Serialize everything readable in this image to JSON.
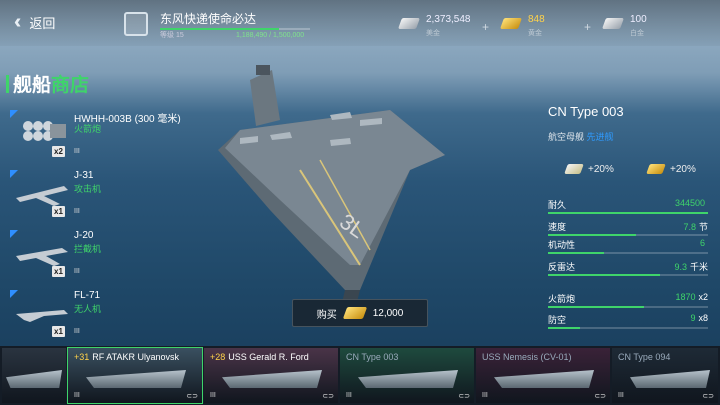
{
  "topbar": {
    "back_label": "返回",
    "mission_title": "东风快递使命必达",
    "mission_level": "等级 15",
    "mission_progress_text": "1,188,490 / 1,500,000",
    "mission_progress": 0.79,
    "resources": [
      {
        "value": "2,373,548",
        "label": "美金",
        "kind": "silver"
      },
      {
        "value": "848",
        "label": "黄金",
        "kind": "gold"
      },
      {
        "value": "100",
        "label": "白金",
        "kind": "silver"
      }
    ]
  },
  "shop": {
    "title_white": "舰船",
    "title_green": "商店",
    "items": [
      {
        "name": "HWHH-003B (300 毫米)",
        "sub": "火箭炮",
        "qty": "x2",
        "lvl": "III",
        "icon": "rocket-launcher-icon"
      },
      {
        "name": "J-31",
        "sub": "攻击机",
        "qty": "x1",
        "lvl": "III",
        "icon": "jet-icon"
      },
      {
        "name": "J-20",
        "sub": "拦截机",
        "qty": "x1",
        "lvl": "III",
        "icon": "jet-icon"
      },
      {
        "name": "FL-71",
        "sub": "无人机",
        "qty": "x1",
        "lvl": "III",
        "icon": "drone-icon"
      }
    ]
  },
  "ship": {
    "name": "CN Type 003",
    "type_prefix": "航空母舰",
    "type_highlight": "先进舰",
    "bonuses": [
      "+20%",
      "+20%"
    ],
    "stats": [
      {
        "label": "耐久",
        "value": "344500",
        "unit": "",
        "fill": 1.0
      },
      {
        "label": "速度",
        "value": "7.8",
        "unit": "节",
        "fill": 0.55
      },
      {
        "label": "机动性",
        "value": "6",
        "unit": "",
        "fill": 0.35
      },
      {
        "label": "反雷达",
        "value": "9.3",
        "unit": "千米",
        "fill": 0.7
      },
      {
        "label": "火箭炮",
        "value": "1870",
        "unit": "x2",
        "fill": 0.6
      },
      {
        "label": "防空",
        "value": "9",
        "unit": "x8",
        "fill": 0.2
      }
    ],
    "buy_label": "购买",
    "price": "12,000"
  },
  "shipbar": [
    {
      "name": "",
      "bonus": "",
      "tier": "",
      "bg": "#2a3440"
    },
    {
      "name": "RF ATAKR Ulyanovsk",
      "bonus": "+31",
      "tier": "III",
      "bg": "#3a5060"
    },
    {
      "name": "USS Gerald R. Ford",
      "bonus": "+28",
      "tier": "III",
      "bg": "#4a3448"
    },
    {
      "name": "CN Type 003",
      "bonus": "",
      "tier": "III",
      "bg": "#1e4a3e"
    },
    {
      "name": "USS Nemesis (CV-01)",
      "bonus": "",
      "tier": "III",
      "bg": "#3a2238"
    },
    {
      "name": "CN Type 094",
      "bonus": "",
      "tier": "III",
      "bg": "#1e2a36"
    }
  ],
  "colors": {
    "accent_green": "#3fd46a",
    "accent_blue": "#2f8fff",
    "gold": "#e8b020"
  }
}
